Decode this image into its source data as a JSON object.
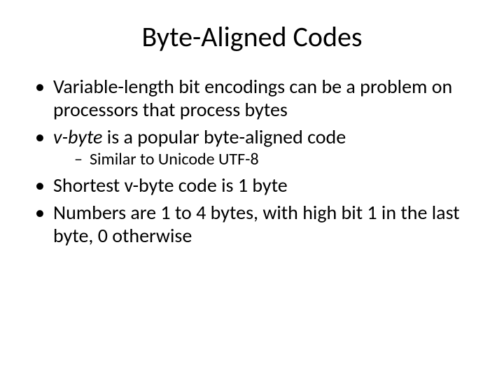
{
  "title": "Byte-Aligned Codes",
  "bullets": {
    "b1": "Variable-length bit encodings can be a problem on processors that process bytes",
    "b2_prefix_italic": "v-byte",
    "b2_rest": " is a popular byte-aligned code",
    "b2_sub1": "Similar to Unicode UTF-8",
    "b3": "Shortest v-byte code is 1 byte",
    "b4": "Numbers are 1 to 4 bytes, with high bit 1 in the last byte, 0 otherwise"
  }
}
